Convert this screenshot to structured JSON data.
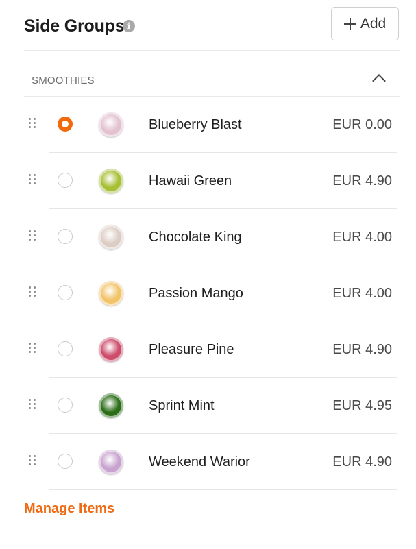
{
  "header": {
    "title": "Side Groups",
    "info_icon": "info-icon",
    "add_label": "Add",
    "add_icon": "plus-icon"
  },
  "group": {
    "title": "SMOOTHIES",
    "toggle_icon": "chevron-up-icon"
  },
  "items": [
    {
      "name": "Blueberry Blast",
      "price": "EUR 0.00",
      "selected": true,
      "thumb_color": "#e3c2d0"
    },
    {
      "name": "Hawaii Green",
      "price": "EUR 4.90",
      "selected": false,
      "thumb_color": "#a7bf35"
    },
    {
      "name": "Chocolate King",
      "price": "EUR 4.00",
      "selected": false,
      "thumb_color": "#dccdc4"
    },
    {
      "name": "Passion Mango",
      "price": "EUR 4.00",
      "selected": false,
      "thumb_color": "#f2c46a"
    },
    {
      "name": "Pleasure Pine",
      "price": "EUR 4.90",
      "selected": false,
      "thumb_color": "#cd4c6b"
    },
    {
      "name": "Sprint Mint",
      "price": "EUR 4.95",
      "selected": false,
      "thumb_color": "#2b6e17"
    },
    {
      "name": "Weekend Warior",
      "price": "EUR 4.90",
      "selected": false,
      "thumb_color": "#c8a3cf"
    }
  ],
  "footer": {
    "manage_label": "Manage Items"
  },
  "colors": {
    "accent": "#f06a0e",
    "link": "#ef6a12"
  }
}
